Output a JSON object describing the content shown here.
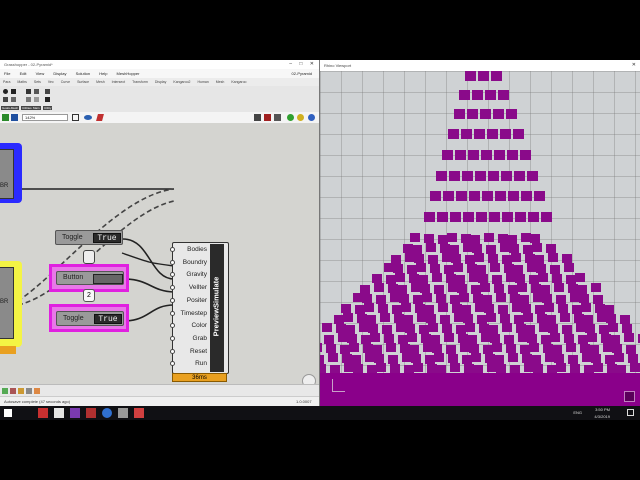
{
  "grasshopper": {
    "window_title": "Grasshopper - 02-Pyramid*",
    "document_name": "02-Pyramid",
    "menu": [
      "File",
      "Edit",
      "View",
      "Display",
      "Solution",
      "Help",
      "MeshHopper"
    ],
    "tabs": [
      "Para",
      "Maths",
      "Sets",
      "Vec",
      "Curve",
      "Surface",
      "Mesh",
      "Intersect",
      "Transform",
      "Display",
      "Kangaroo2",
      "Human",
      "Mesh",
      "Kangaroo"
    ],
    "ribbon_groups": [
      "Goals-Mesh",
      "Utilities",
      "Main",
      "Utility"
    ],
    "zoom": "142%",
    "status": "Autosave complete (47 seconds ago)",
    "version": "1.0.0007",
    "components": {
      "toggle1": {
        "label": "Toggle",
        "value": "True"
      },
      "button": {
        "label": "Button"
      },
      "toggle2": {
        "label": "Toggle",
        "value": "True"
      },
      "relay_number": "2",
      "left_label_top": "BR",
      "left_label_bottom": "BR",
      "preview": {
        "name": "PreviewSimulate",
        "inputs": [
          "Bodies",
          "Boundry",
          "Gravity",
          "Vellter",
          "Positer",
          "Timestep",
          "Color",
          "Grab",
          "Reset",
          "Run"
        ],
        "timer": "36ms"
      }
    }
  },
  "rhino": {
    "viewport_title": "Rhino Viewport"
  },
  "taskbar": {
    "lang": "ENG",
    "time": "3:50 PM",
    "date": "4/3/2019"
  },
  "colors": {
    "brick": "#8a0a8a",
    "select_pink": "#e020e0",
    "left_blue": "#2a2aff",
    "left_yellow": "#f4f444",
    "timer_orange": "#e9a020"
  }
}
